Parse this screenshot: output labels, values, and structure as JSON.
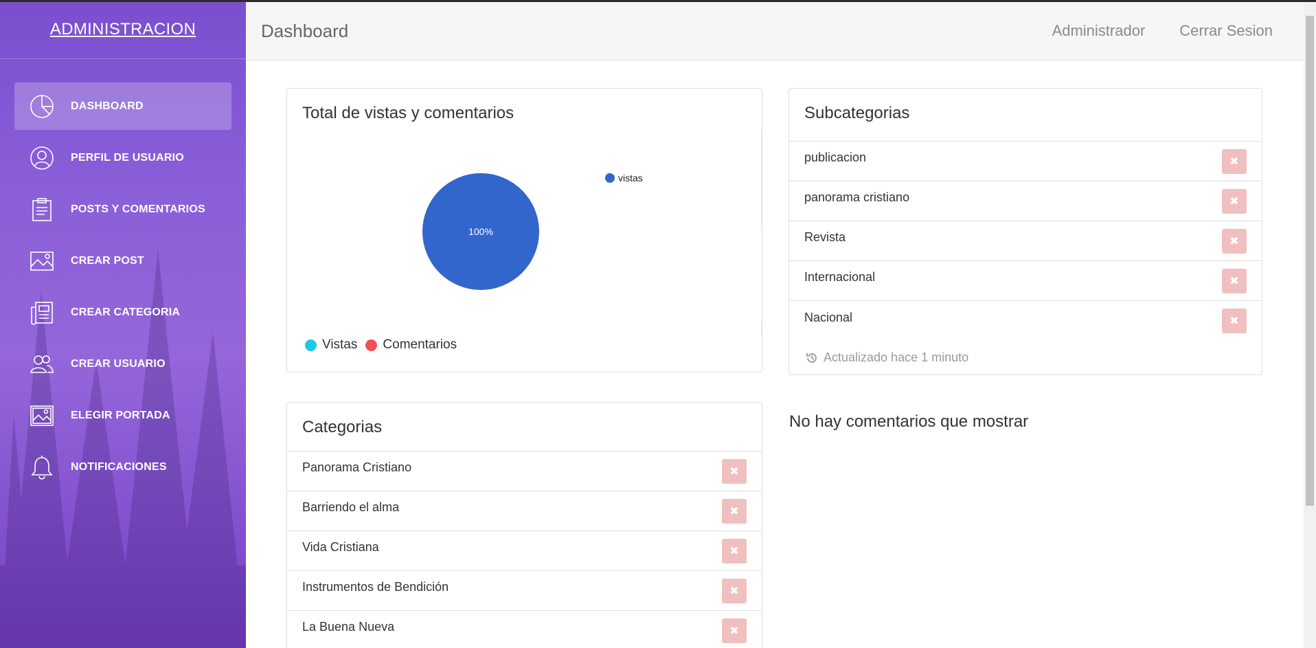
{
  "sidebar": {
    "brand": "ADMINISTRACION",
    "items": [
      {
        "label": "DASHBOARD",
        "icon": "pie-chart-icon",
        "active": true
      },
      {
        "label": "PERFIL DE USUARIO",
        "icon": "user-icon",
        "active": false
      },
      {
        "label": "POSTS Y COMENTARIOS",
        "icon": "clipboard-icon",
        "active": false
      },
      {
        "label": "CREAR POST",
        "icon": "image-icon",
        "active": false
      },
      {
        "label": "CREAR CATEGORIA",
        "icon": "newspaper-icon",
        "active": false
      },
      {
        "label": "CREAR USUARIO",
        "icon": "users-icon",
        "active": false
      },
      {
        "label": "ELEGIR PORTADA",
        "icon": "picture-icon",
        "active": false
      },
      {
        "label": "NOTIFICACIONES",
        "icon": "bell-icon",
        "active": false
      }
    ]
  },
  "header": {
    "title": "Dashboard",
    "user_label": "Administrador",
    "logout_label": "Cerrar Sesion"
  },
  "chart_card": {
    "title": "Total de vistas y comentarios",
    "legend_footer": [
      {
        "label": "Vistas",
        "color": "#1fc8e3"
      },
      {
        "label": "Comentarios",
        "color": "#f24e5b"
      }
    ]
  },
  "chart_data": {
    "type": "pie",
    "title": "Total de vistas y comentarios",
    "slices": [
      {
        "label": "vistas",
        "value": 100,
        "display": "100%",
        "color": "#3366cc"
      }
    ],
    "legend": {
      "position": "top-right",
      "entries": [
        "vistas"
      ]
    }
  },
  "subcategories": {
    "title": "Subcategorias",
    "items": [
      "publicacion",
      "panorama cristiano",
      "Revista",
      "Internacional",
      "Nacional"
    ],
    "updated": "Actualizado hace 1 minuto"
  },
  "categories": {
    "title": "Categorias",
    "items": [
      "Panorama Cristiano",
      "Barriendo el alma",
      "Vida Cristiana",
      "Instrumentos de Bendición",
      "La Buena Nueva"
    ]
  },
  "comments": {
    "empty_text": "No hay comentarios que mostrar"
  },
  "colors": {
    "accent": "#8b5fd8",
    "delete_button": "#f0c0c0",
    "pie": "#3366cc"
  }
}
